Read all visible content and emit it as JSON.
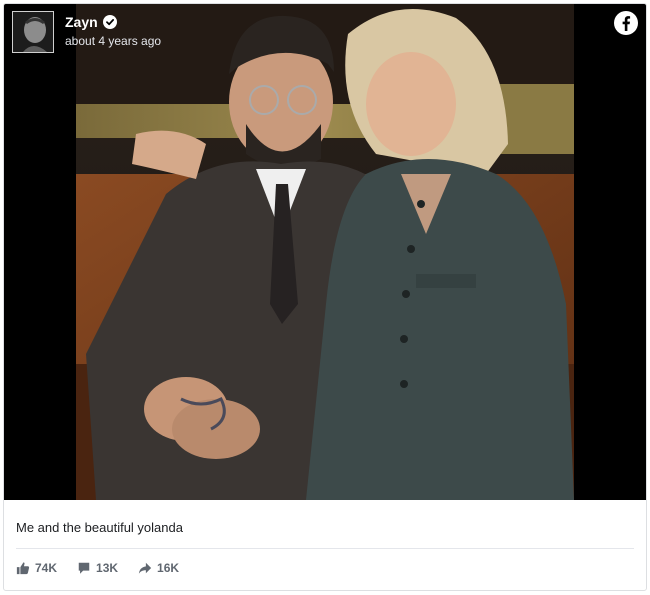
{
  "post": {
    "author": "Zayn",
    "time": "about 4 years ago",
    "caption": "Me and the beautiful yolanda",
    "stats": {
      "likes": "74K",
      "comments": "13K",
      "shares": "16K"
    }
  },
  "icons": {
    "verified": "verified-badge-icon",
    "facebook": "facebook-icon",
    "like": "thumbs-up-icon",
    "comment": "comment-icon",
    "share": "share-arrow-icon"
  },
  "colors": {
    "brand": "#1877f2",
    "text": "#1c1e21",
    "muted": "#606770"
  }
}
